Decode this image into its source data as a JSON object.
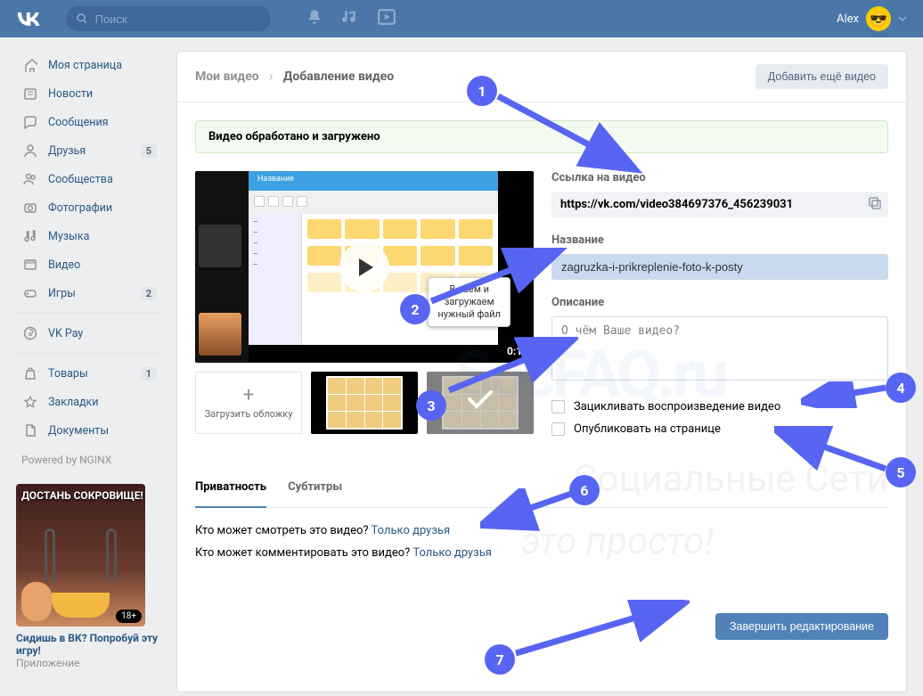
{
  "header": {
    "search_placeholder": "Поиск",
    "user_name": "Alex"
  },
  "sidebar": {
    "items": [
      {
        "label": "Моя страница",
        "icon": "home"
      },
      {
        "label": "Новости",
        "icon": "news"
      },
      {
        "label": "Сообщения",
        "icon": "message"
      },
      {
        "label": "Друзья",
        "icon": "user",
        "badge": "5"
      },
      {
        "label": "Сообщества",
        "icon": "users"
      },
      {
        "label": "Фотографии",
        "icon": "camera"
      },
      {
        "label": "Музыка",
        "icon": "music"
      },
      {
        "label": "Видео",
        "icon": "video"
      },
      {
        "label": "Игры",
        "icon": "gamepad",
        "badge": "2"
      }
    ],
    "items2": [
      {
        "label": "VK Pay",
        "icon": "ruble"
      }
    ],
    "items3": [
      {
        "label": "Товары",
        "icon": "bag",
        "badge": "1"
      },
      {
        "label": "Закладки",
        "icon": "star"
      },
      {
        "label": "Документы",
        "icon": "document"
      }
    ],
    "powered": "Powered by NGINX"
  },
  "ad": {
    "image_title": "ДОСТАНЬ СОКРОВИЩЕ!",
    "r18": "18+",
    "title": "Сидишь в ВК? Попробуй эту игру!",
    "sub": "Приложение"
  },
  "breadcrumb": {
    "parent": "Мои видео",
    "current": "Добавление видео"
  },
  "add_more_btn": "Добавить ещё видео",
  "alert": "Видео обработано и загружено",
  "video": {
    "duration": "0:11",
    "tooltip_line1": "В...аем и",
    "tooltip_line2": "загружаем",
    "tooltip_line3": "нужный файл",
    "upload_cover": "Загрузить обложку"
  },
  "form": {
    "link_label": "Ссылка на видео",
    "link_value": "https://vk.com/video384697376_456239031",
    "title_label": "Название",
    "title_value": "zagruzka-i-prikreplenie-foto-k-posty",
    "desc_label": "Описание",
    "desc_placeholder": "О чём Ваше видео?",
    "cb_loop": "Зацикливать воспроизведение видео",
    "cb_publish": "Опубликовать на странице"
  },
  "tabs": {
    "privacy": "Приватность",
    "subtitles": "Субтитры"
  },
  "privacy": {
    "view_q": "Кто может смотреть это видео?",
    "view_v": "Только друзья",
    "comment_q": "Кто может комментировать это видео?",
    "comment_v": "Только друзья"
  },
  "submit": "Завершить редактирование",
  "watermark": {
    "logo": "SocFAQ.ru",
    "line1": "Социальные Сети",
    "line2": "это просто!"
  },
  "bubbles": [
    "1",
    "2",
    "3",
    "4",
    "5",
    "6",
    "7"
  ]
}
